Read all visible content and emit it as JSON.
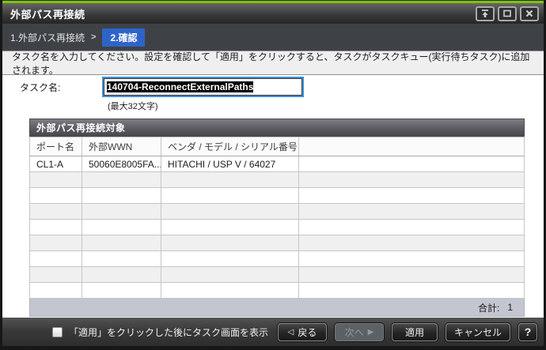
{
  "colors": {
    "top_accent_green": "#7dc600",
    "active_step_blue": "#2e64c9",
    "selection_bg": "#000000",
    "selection_text": "#ffffff",
    "total_bar_bg": "#c3c6d0",
    "input_focus_ring": "#3f8fd8"
  },
  "window": {
    "title": "外部パス再接続"
  },
  "breadcrumb": {
    "step1": "1.外部パス再接続",
    "separator": ">",
    "active_step": "2.確認"
  },
  "instruction": "タスク名を入力してください。設定を確認して「適用」をクリックすると、タスクがタスクキュー(実行待ちタスク)に追加されます。",
  "task": {
    "label": "タスク名:",
    "value": "140704-ReconnectExternalPaths",
    "hint": "(最大32文字)"
  },
  "table": {
    "title": "外部パス再接続対象",
    "columns": [
      "ポート名",
      "外部WWN",
      "ベンダ / モデル / シリアル番号",
      ""
    ],
    "rows": [
      [
        "CL1-A",
        "50060E8005FA...",
        "HITACHI / USP V / 64027",
        ""
      ]
    ],
    "empty_rows": 8,
    "total_label": "合計:",
    "total_value": "1"
  },
  "footer": {
    "checkbox_label": "「適用」をクリックした後にタスク画面を表示",
    "checkbox_checked": false,
    "back_icon": "◁",
    "back_label": "戻る",
    "next_label": "次へ",
    "next_icon": "▶",
    "apply_label": "適用",
    "cancel_label": "キャンセル",
    "help_label": "?"
  }
}
